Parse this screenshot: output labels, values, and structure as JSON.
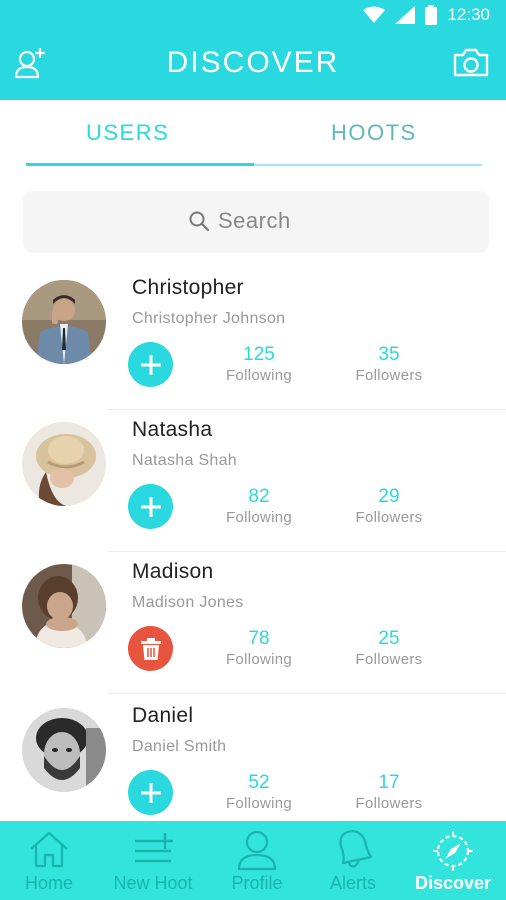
{
  "status_bar": {
    "time": "12:30"
  },
  "app_bar": {
    "title": "DISCOVER",
    "left_icon": "add-user-icon",
    "right_icon": "camera-icon"
  },
  "tabs": [
    {
      "label": "USERS",
      "active": true
    },
    {
      "label": "HOOTS",
      "active": false
    }
  ],
  "search": {
    "placeholder": "Search"
  },
  "users": [
    {
      "name": "Christopher",
      "full_name": "Christopher Johnson",
      "following": "125",
      "following_label": "Following",
      "followers": "35",
      "followers_label": "Followers",
      "action": "add"
    },
    {
      "name": "Natasha",
      "full_name": "Natasha Shah",
      "following": "82",
      "following_label": "Following",
      "followers": "29",
      "followers_label": "Followers",
      "action": "add"
    },
    {
      "name": "Madison",
      "full_name": "Madison Jones",
      "following": "78",
      "following_label": "Following",
      "followers": "25",
      "followers_label": "Followers",
      "action": "delete"
    },
    {
      "name": "Daniel",
      "full_name": "Daniel Smith",
      "following": "52",
      "following_label": "Following",
      "followers": "17",
      "followers_label": "Followers",
      "action": "add"
    }
  ],
  "bottom_nav": [
    {
      "label": "Home",
      "icon": "home-icon",
      "active": false
    },
    {
      "label": "New Hoot",
      "icon": "new-hoot-icon",
      "active": false
    },
    {
      "label": "Profile",
      "icon": "profile-icon",
      "active": false
    },
    {
      "label": "Alerts",
      "icon": "bell-icon",
      "active": false
    },
    {
      "label": "Discover",
      "icon": "compass-icon",
      "active": true
    }
  ],
  "colors": {
    "accent": "#2ad8df",
    "nav_background": "#32e4dc",
    "delete": "#e8553e",
    "muted": "#999999"
  }
}
